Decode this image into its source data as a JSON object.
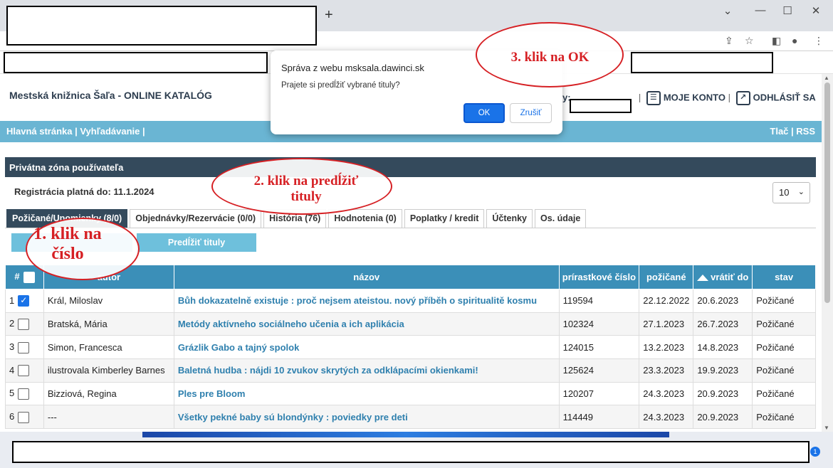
{
  "browser": {
    "new_tab_glyph": "+",
    "win_minimize": "⌄",
    "win_min": "—",
    "win_max": "☐",
    "win_close": "✕"
  },
  "site": {
    "title": "Mestská knižnica Šaľa - ONLINE KATALÓG",
    "user_prefix": "y:",
    "my_account": "MOJE KONTO",
    "logout": "ODHLÁSIŤ SA",
    "sep": "|"
  },
  "nav": {
    "left": "Hlavná stránka | Vyhľadávanie |",
    "right": "Tlač | RSS"
  },
  "panel": {
    "title": "Privátna zóna používateľa",
    "registration": "Registrácia platná do: 11.1.2024",
    "per_page": "10"
  },
  "tabs": [
    {
      "label": "Požičané/Upomienky (8/0)"
    },
    {
      "label": "Objednávky/Rezervácie (0/0)"
    },
    {
      "label": "História (76)"
    },
    {
      "label": "Hodnotenia (0)"
    },
    {
      "label": "Poplatky / kredit"
    },
    {
      "label": "Účtenky"
    },
    {
      "label": "Os. údaje"
    }
  ],
  "buttons": {
    "renew": "Predĺžiť tituly"
  },
  "table": {
    "headers": {
      "num": "#",
      "author": "autor",
      "title": "názov",
      "accession": "prírastkové číslo",
      "borrowed": "požičané",
      "due": "vrátiť do",
      "status": "stav"
    },
    "rows": [
      {
        "n": "1",
        "author": "Král, Miloslav",
        "title": "Bůh dokazatelně existuje : proč nejsem ateistou. nový příběh o spiritualitě kosmu",
        "acc": "119594",
        "borrowed": "22.12.2022",
        "due": "20.6.2023",
        "status": "Požičané",
        "checked": true
      },
      {
        "n": "2",
        "author": "Bratská, Mária",
        "title": "Metódy aktívneho sociálneho učenia a ich aplikácia",
        "acc": "102324",
        "borrowed": "27.1.2023",
        "due": "26.7.2023",
        "status": "Požičané",
        "checked": false
      },
      {
        "n": "3",
        "author": "Simon, Francesca",
        "title": "Grázlik Gabo a tajný spolok",
        "acc": "124015",
        "borrowed": "13.2.2023",
        "due": "14.8.2023",
        "status": "Požičané",
        "checked": false
      },
      {
        "n": "4",
        "author": "ilustrovala Kimberley Barnes",
        "title": "Baletná hudba : nájdi 10 zvukov skrytých za odklápacími okienkami!",
        "acc": "125624",
        "borrowed": "23.3.2023",
        "due": "19.9.2023",
        "status": "Požičané",
        "checked": false
      },
      {
        "n": "5",
        "author": "Bizziová, Regina",
        "title": "Ples pre Bloom",
        "acc": "120207",
        "borrowed": "24.3.2023",
        "due": "20.9.2023",
        "status": "Požičané",
        "checked": false
      },
      {
        "n": "6",
        "author": "---",
        "title": "Všetky pekné baby sú blondýnky : poviedky pre deti",
        "acc": "114449",
        "borrowed": "24.3.2023",
        "due": "20.9.2023",
        "status": "Požičané",
        "checked": false
      }
    ]
  },
  "dialog": {
    "title": "Správa z webu msksala.dawinci.sk",
    "message": "Prajete si predĺžiť vybrané tituly?",
    "ok": "OK",
    "cancel": "Zrušiť"
  },
  "annotations": {
    "step1_line1": "1. klik na",
    "step1_line2": "číslo",
    "step2_line1": "2. klik na predĺžiť",
    "step2_line2": "tituly",
    "step3": "3. klik na OK"
  },
  "taskbar": {
    "badge": "1"
  },
  "colors": {
    "nav": "#6ab5d3",
    "panel_head": "#344a5c",
    "table_head": "#3b8fb8",
    "link": "#2f80ae",
    "annotation": "#d62024",
    "primary": "#1a73e8"
  }
}
